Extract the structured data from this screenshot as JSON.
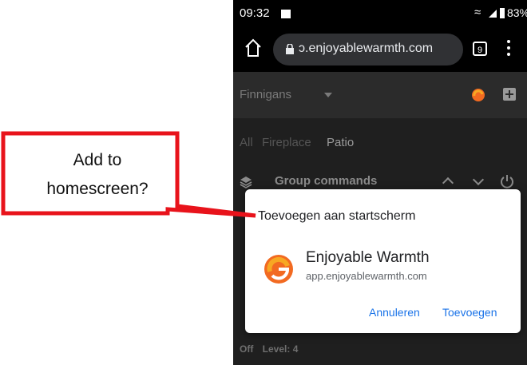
{
  "status_bar": {
    "time": "09:32",
    "battery": "83%"
  },
  "browser": {
    "url": "ɔ.enjoyablewarmth.com",
    "tab_count": "9"
  },
  "site": {
    "name": "Finnigans",
    "filters": [
      "All",
      "Fireplace",
      "Patio"
    ],
    "group_commands": "Group commands",
    "bottom_state": "Off",
    "bottom_level": "Level: 4"
  },
  "dialog": {
    "title": "Toevoegen aan startscherm",
    "app_name": "Enjoyable Warmth",
    "app_url": "app.enjoyablewarmth.com",
    "cancel_label": "Annuleren",
    "add_label": "Toevoegen"
  },
  "callout": {
    "line1": "Add to",
    "line2": "homescreen?"
  },
  "colors": {
    "accent_blue": "#1a73e8",
    "callout_red": "#e8131b",
    "logo_orange": "#f26a21",
    "logo_yellow": "#f7a823"
  }
}
